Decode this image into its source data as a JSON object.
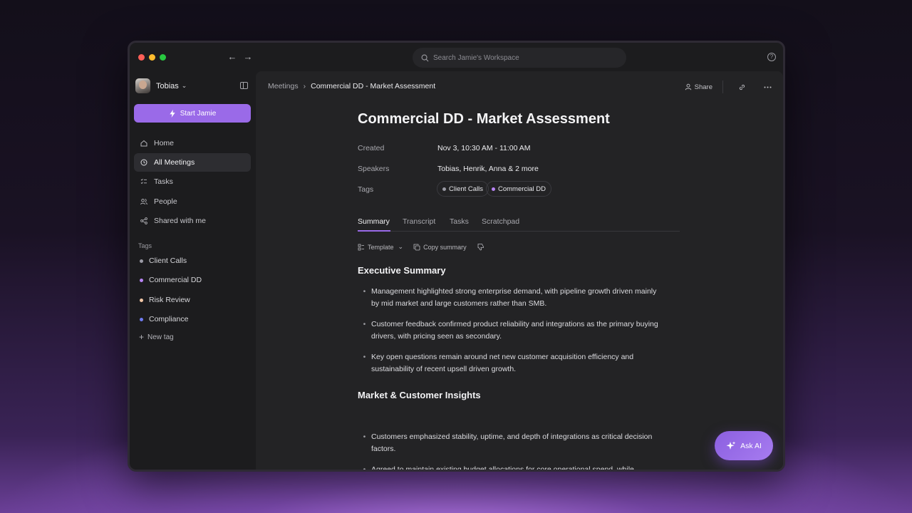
{
  "search": {
    "placeholder": "Search Jamie's Workspace"
  },
  "user": {
    "name": "Tobias"
  },
  "sidebar": {
    "start_label": "Start Jamie",
    "items": [
      {
        "label": "Home",
        "icon": "home-icon"
      },
      {
        "label": "All Meetings",
        "icon": "clock-icon"
      },
      {
        "label": "Tasks",
        "icon": "tasks-icon"
      },
      {
        "label": "People",
        "icon": "people-icon"
      },
      {
        "label": "Shared with me",
        "icon": "share-icon"
      }
    ],
    "tags_heading": "Tags",
    "tags": [
      {
        "label": "Client Calls",
        "color": "#9b9ba6"
      },
      {
        "label": "Commercial DD",
        "color": "#b884f5"
      },
      {
        "label": "Risk Review",
        "color": "#f3c8a6"
      },
      {
        "label": "Compliance",
        "color": "#6f7cf2"
      }
    ],
    "new_tag": "New tag"
  },
  "breadcrumb": {
    "parent": "Meetings",
    "current": "Commercial DD - Market Assessment"
  },
  "actions": {
    "share": "Share"
  },
  "doc": {
    "title": "Commercial DD - Market Assessment",
    "meta": {
      "created_label": "Created",
      "created_value": "Nov 3, 10:30 AM - 11:00 AM",
      "speakers_label": "Speakers",
      "speakers_value": "Tobias, Henrik, Anna & 2 more",
      "tags_label": "Tags",
      "tags": [
        "Client Calls",
        "Commercial DD"
      ]
    },
    "tabs": [
      "Summary",
      "Transcript",
      "Tasks",
      "Scratchpad"
    ],
    "toolbar": {
      "template": "Template",
      "copy": "Copy summary"
    },
    "sections": [
      {
        "heading": "Executive Summary",
        "bullets": [
          "Management highlighted strong enterprise demand, with pipeline growth driven mainly by mid market and large customers rather than SMB.",
          "Customer feedback confirmed product reliability and integrations as the primary buying drivers, with pricing seen as secondary.",
          "Key open questions remain around net new customer acquisition efficiency and sustainability of recent upsell driven growth."
        ]
      },
      {
        "heading": "Market & Customer Insights",
        "bullets": [
          "Customers emphasized stability, uptime, and depth of integrations as critical decision factors.",
          "Agreed to maintain existing budget allocations for core operational spend, while"
        ]
      }
    ]
  },
  "ask_ai": "Ask AI"
}
